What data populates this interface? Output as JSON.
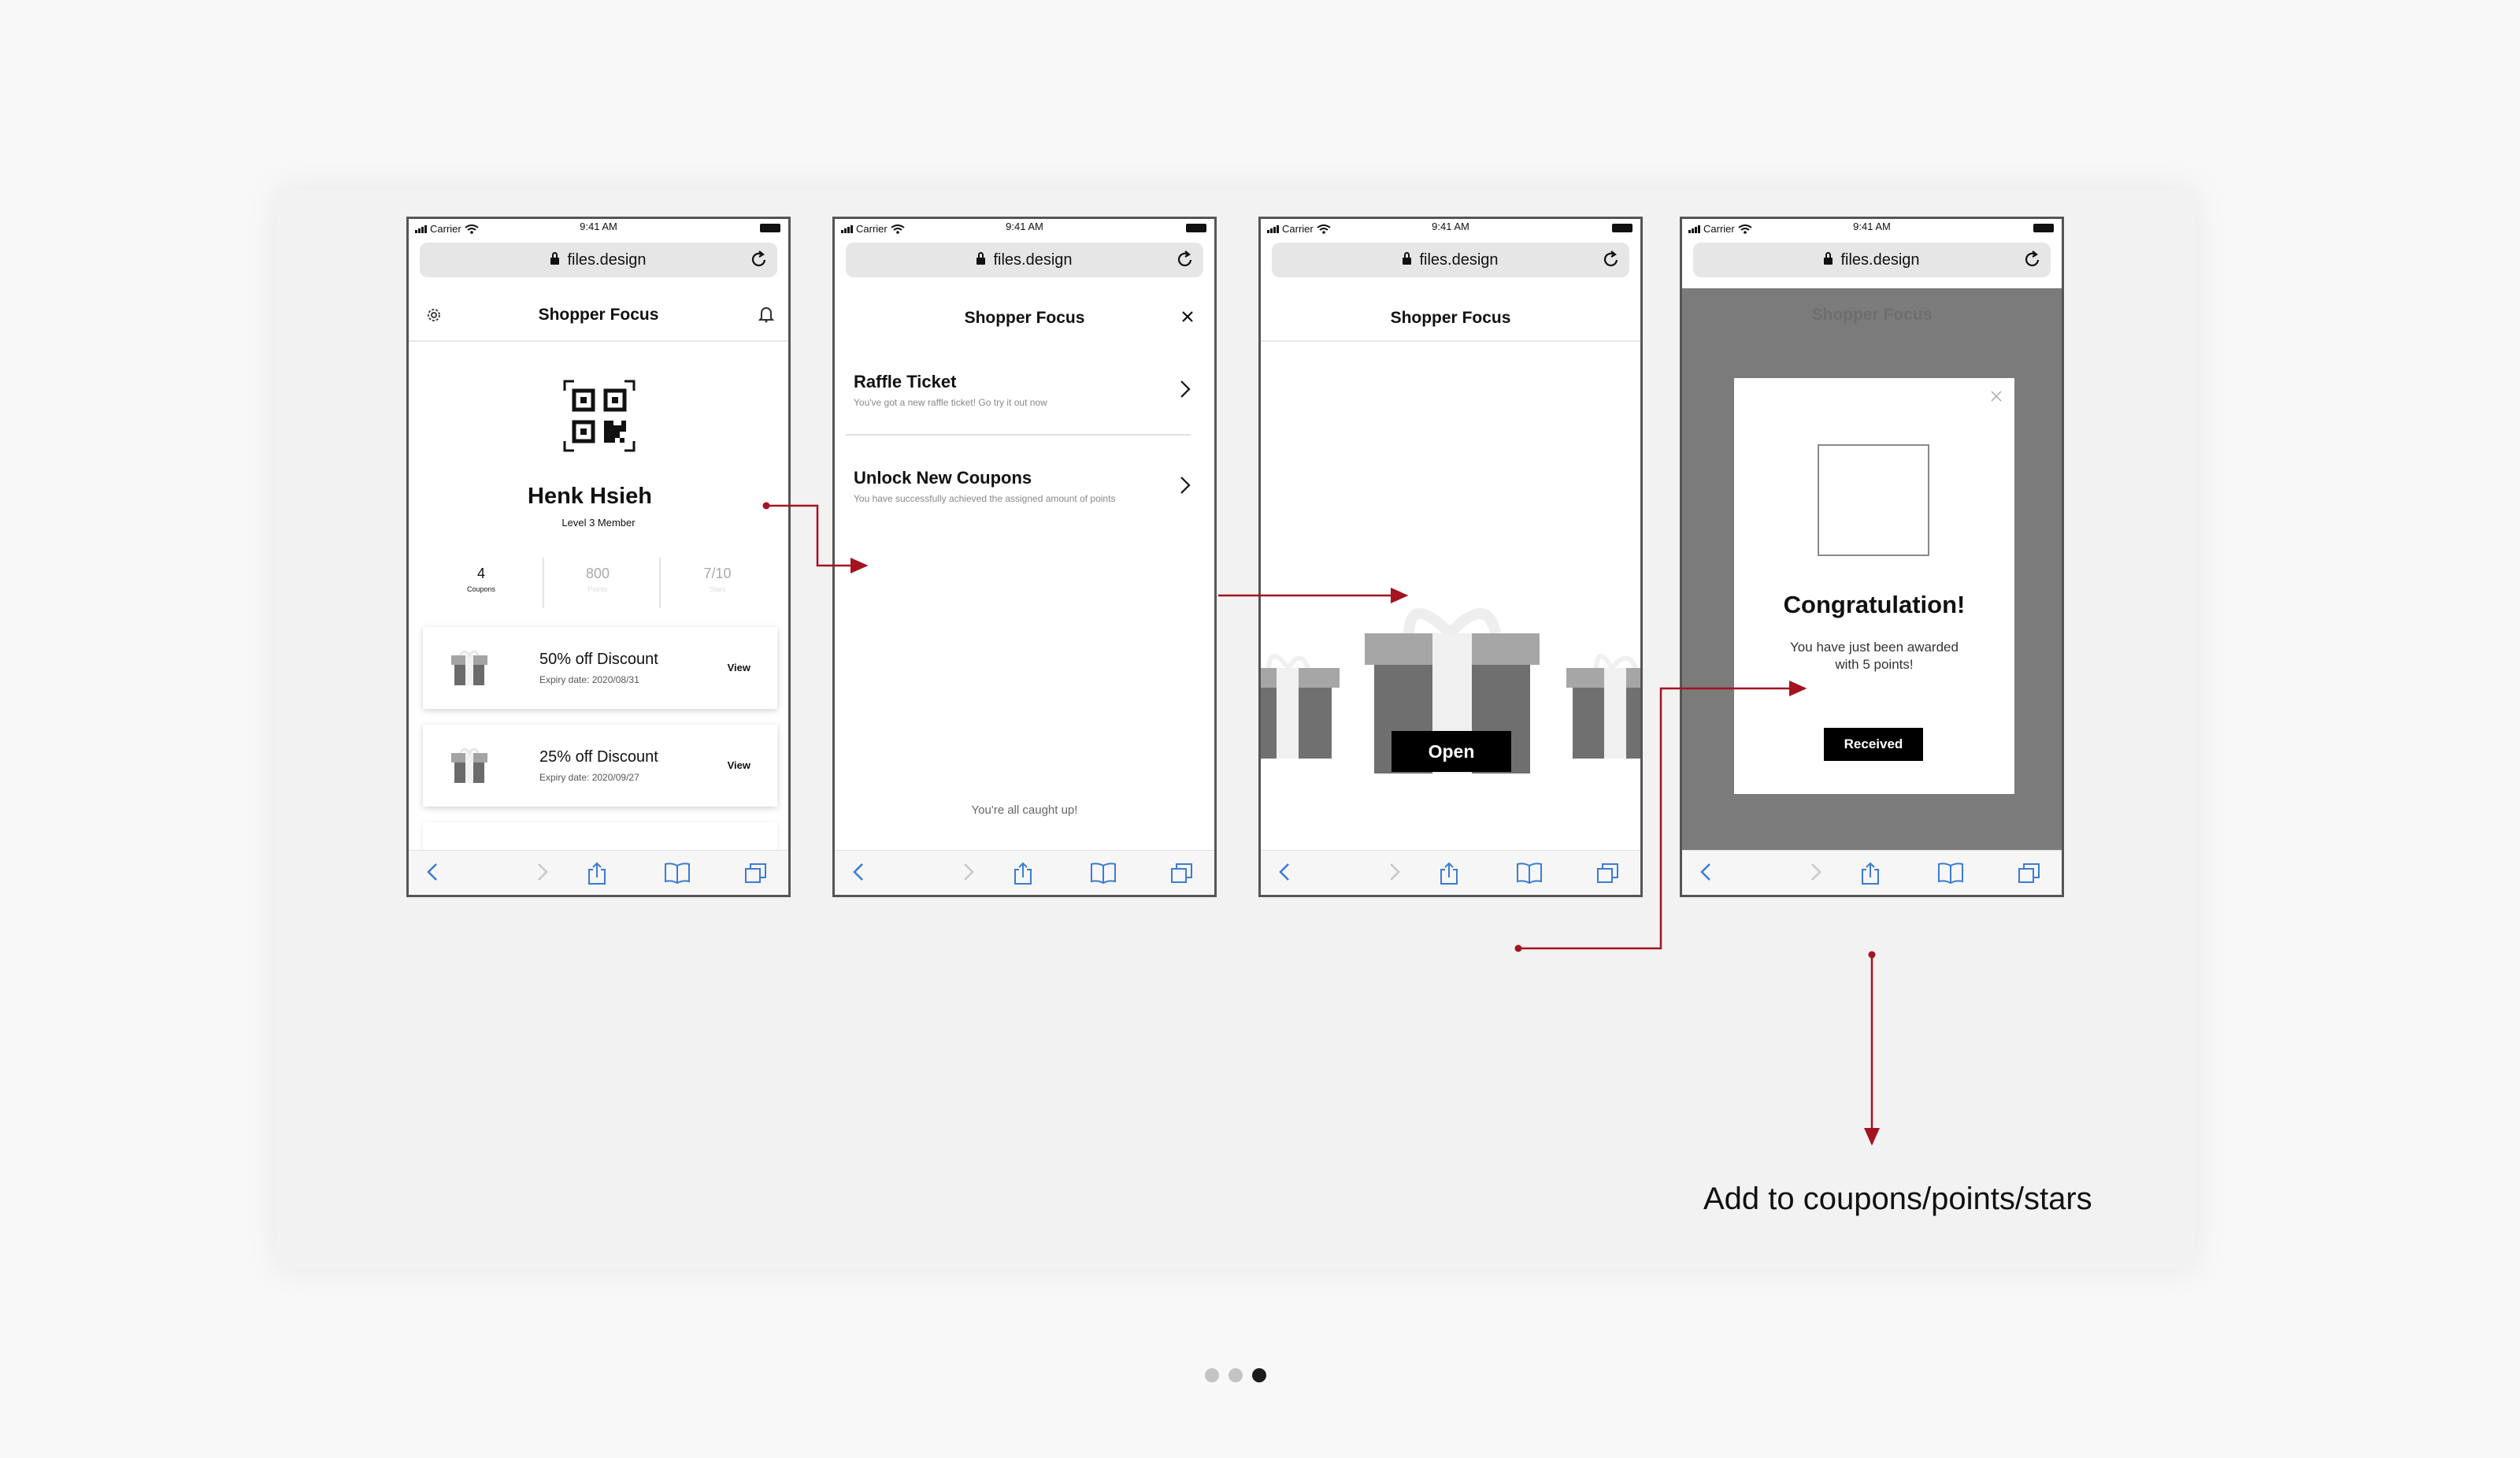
{
  "app": {
    "status_carrier": "Carrier",
    "status_time": "9:41 AM",
    "url": "files.design",
    "title": "Shopper Focus"
  },
  "screen1": {
    "user_name": "Henk Hsieh",
    "member_level": "Level 3 Member",
    "stats": [
      {
        "value": "4",
        "label": "Coupons"
      },
      {
        "value": "800",
        "label": "Points"
      },
      {
        "value": "7/10",
        "label": "Stars"
      }
    ],
    "coupons": [
      {
        "title": "50% off Discount",
        "expiry": "Expiry date: 2020/08/31",
        "action": "View"
      },
      {
        "title": "25% off Discount",
        "expiry": "Expiry date: 2020/09/27",
        "action": "View"
      }
    ]
  },
  "screen2": {
    "notifications": [
      {
        "title": "Raffle Ticket",
        "subtitle": "You've got a new raffle ticket! Go try it out now"
      },
      {
        "title": "Unlock New Coupons",
        "subtitle": "You have successfully achieved the assigned amount of points"
      }
    ],
    "empty_message": "You're all caught up!"
  },
  "screen3": {
    "open_button": "Open"
  },
  "screen4": {
    "modal_title": "Congratulation!",
    "modal_line1": "You have just been awarded",
    "modal_line2": "with 5 points!",
    "received_button": "Received"
  },
  "annotation": "Add to coupons/points/stars",
  "pagination": {
    "total": 3,
    "active_index": 2
  },
  "colors": {
    "arrow": "#a31420",
    "accent_blue": "#3a7bd5",
    "overlay": "#7b7b7b"
  }
}
